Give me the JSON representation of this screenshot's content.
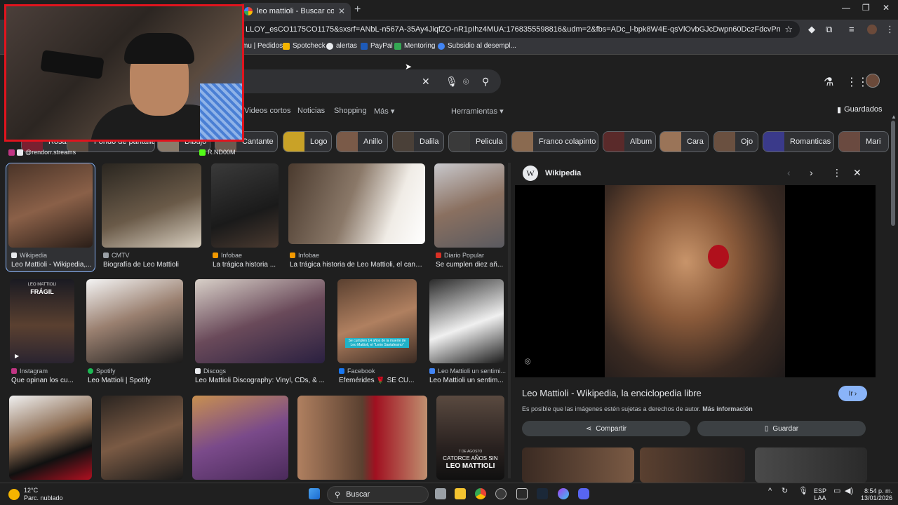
{
  "browser": {
    "tab": {
      "title": "leo mattioli - Buscar con Goog"
    },
    "address": "LLOY_esCO1175CO1175&sxsrf=ANbL-n567A-35Ay4JiqfZO-nR1pIhz4MUA:1768355598816&udm=2&fbs=ADc_l-bpk8W4E-qsVlOvbGJcDwpn60DczFdcvPnuv8WQohHLTaMb_WtLz8zQ41...",
    "bookmarks": [
      "mu | Pedidos",
      "Spotcheck",
      "alertas",
      "PayPal",
      "Mentoring",
      "Subsidio al desempl..."
    ]
  },
  "search": {
    "tabs": [
      "Videos cortos",
      "Noticias",
      "Shopping",
      "Más"
    ],
    "tools": "Herramientas",
    "saved": "Guardados"
  },
  "chips": [
    "Rosa",
    "Fondo de pantalla",
    "Dibujo",
    "Cantante",
    "Logo",
    "Anillo",
    "Dalila",
    "Pelicula",
    "Franco colapinto",
    "Album",
    "Cara",
    "Ojo",
    "Romanticas",
    "Mari"
  ],
  "results": [
    {
      "source": "Wikipedia",
      "caption": "Leo Mattioli - Wikipedia,..."
    },
    {
      "source": "CMTV",
      "caption": "Biografía de Leo Mattioli"
    },
    {
      "source": "Infobae",
      "caption": "La trágica historia ..."
    },
    {
      "source": "Infobae",
      "caption": "La trágica historia de Leo Mattioli, el cant..."
    },
    {
      "source": "Diario Popular",
      "caption": "Se cumplen diez añ..."
    },
    {
      "source": "Instagram",
      "caption": "Que opinan los cu..."
    },
    {
      "source": "Spotify",
      "caption": "Leo Mattioli | Spotify"
    },
    {
      "source": "Discogs",
      "caption": "Leo Mattioli Discography: Vinyl, CDs, & ..."
    },
    {
      "source": "Facebook",
      "caption": "Efemérides 🌹 SE CU..."
    },
    {
      "source": "Leo Mattioli un sentimi...",
      "caption": "Leo Mattioli un sentim..."
    }
  ],
  "image_texts": {
    "album_top": "LEO MATTIOLI",
    "album_title": "FRÁGIL",
    "overlay_note": "Se cumplen 14 años de la muerte de Leo Mattioli, el \"León Santafesino\"",
    "date_small": "7 DE AGOSTO",
    "anniv_line": "CATORCE AÑOS SIN",
    "anniv_name": "LEO MATTIOLI"
  },
  "preview": {
    "site": "Wikipedia",
    "logo_letter": "W",
    "title": "Leo Mattioli - Wikipedia, la enciclopedia libre",
    "go": "Ir",
    "note": "Es posible que las imágenes estén sujetas a derechos de autor.",
    "more": "Más información",
    "share": "Compartir",
    "save": "Guardar"
  },
  "overlay": {
    "socials": [
      "@rendorr.streams",
      "R.ND00M"
    ]
  },
  "taskbar": {
    "temp": "12°C",
    "weather": "Parc. nublado",
    "search": "Buscar",
    "lang1": "ESP",
    "lang2": "LAA",
    "time": "8:54 p. m.",
    "date": "13/01/2026"
  },
  "colors": {
    "accent": "#8ab4f8",
    "cam_border": "#e0141e",
    "bg": "#1f1f1f"
  }
}
